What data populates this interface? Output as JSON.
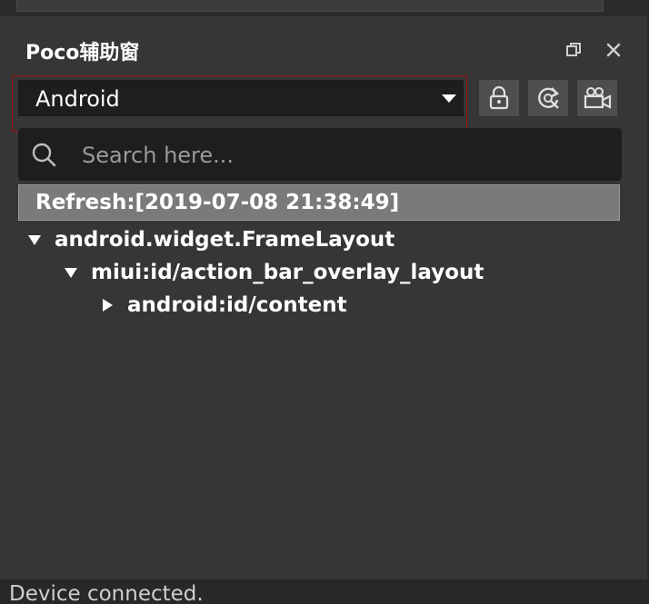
{
  "panel": {
    "title": "Poco辅助窗",
    "restore_icon": "restore-window-icon",
    "close_icon": "close-icon"
  },
  "selector": {
    "value": "Android",
    "highlight_color": "#a01515"
  },
  "toolbar": {
    "buttons": [
      {
        "name": "lock-button",
        "icon": "lock-icon"
      },
      {
        "name": "refresh-button",
        "icon": "refresh-icon"
      },
      {
        "name": "record-button",
        "icon": "video-camera-icon"
      }
    ]
  },
  "search": {
    "placeholder": "Search here...",
    "value": ""
  },
  "tree": {
    "refresh_label": "Refresh:[2019-07-08 21:38:49]",
    "nodes": [
      {
        "label": "android.widget.FrameLayout",
        "expanded": true,
        "depth": 0
      },
      {
        "label": "miui:id/action_bar_overlay_layout",
        "expanded": true,
        "depth": 1
      },
      {
        "label": "android:id/content",
        "expanded": false,
        "depth": 2
      }
    ]
  },
  "status": {
    "text": "Device connected."
  }
}
